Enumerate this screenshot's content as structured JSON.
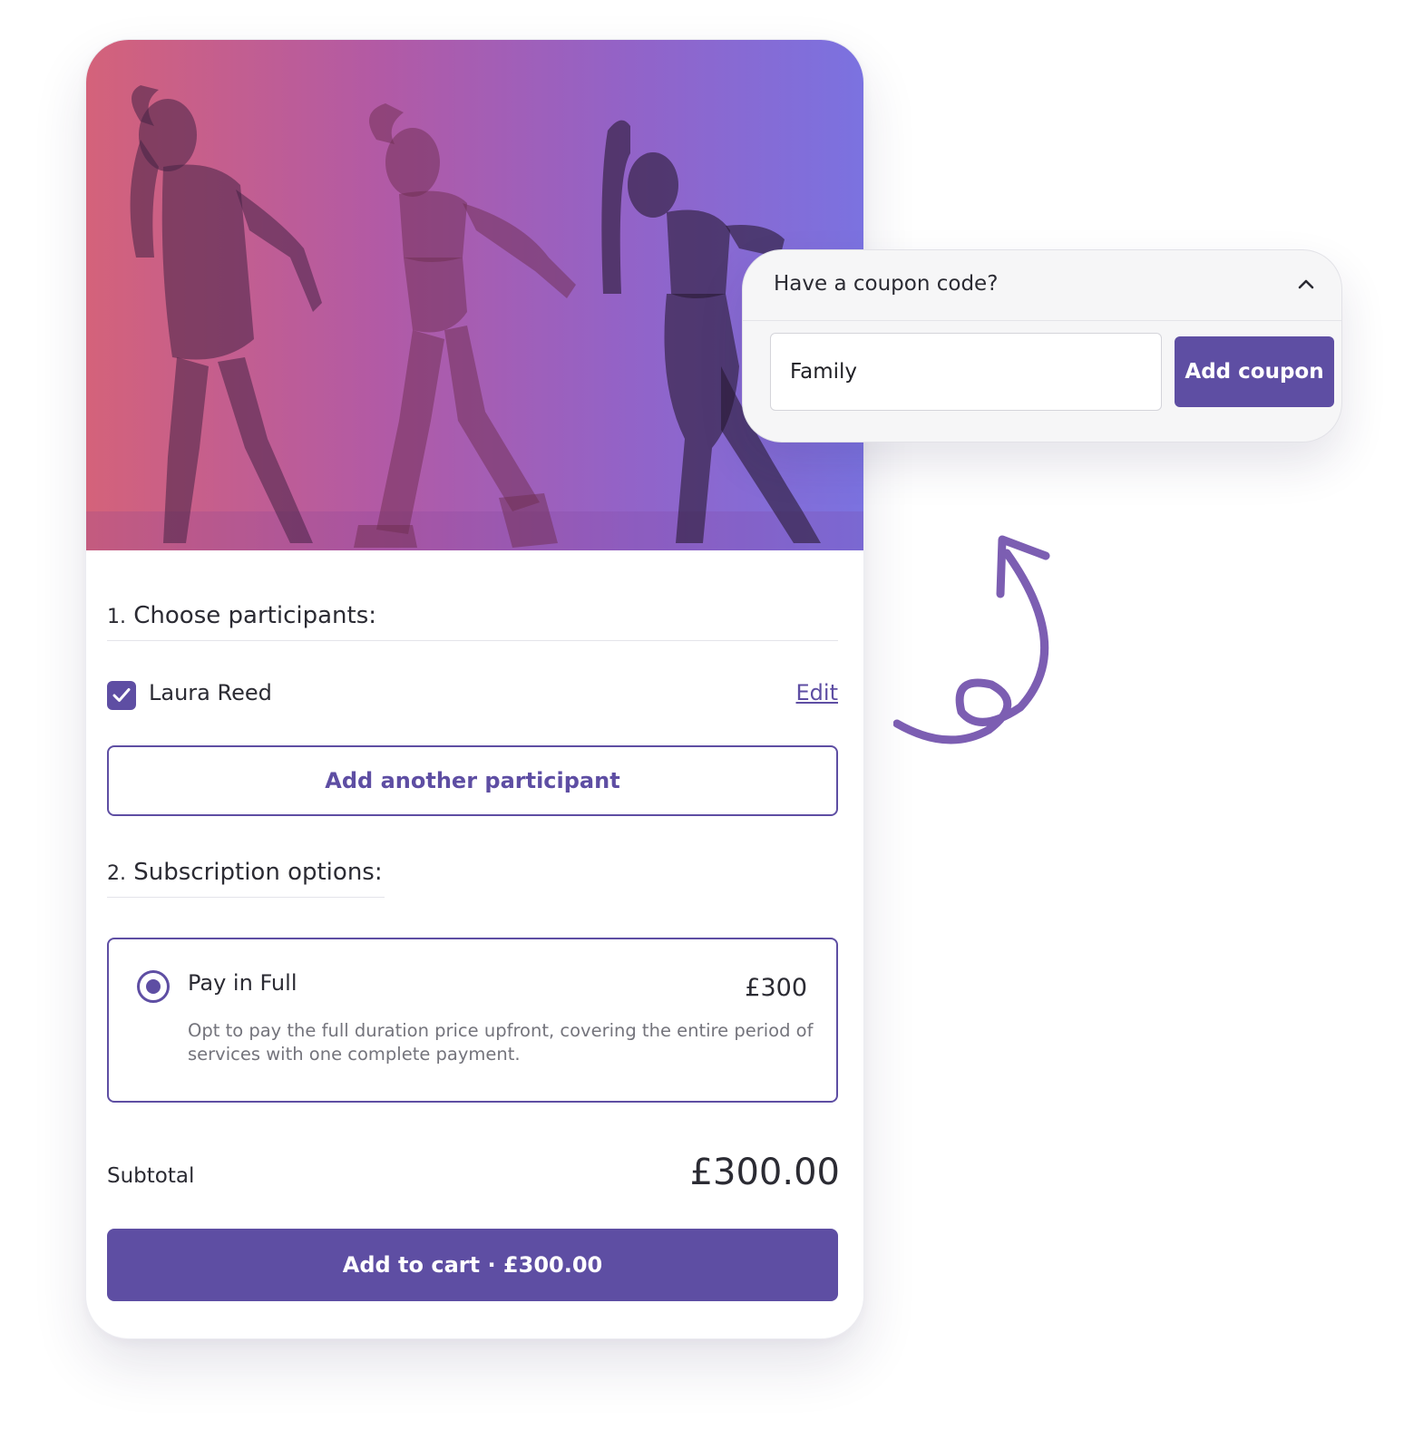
{
  "hero_image": {
    "description_icon": "dancers-photo"
  },
  "participants": {
    "title_number": "1.",
    "title_text": "Choose participants:",
    "items": [
      {
        "name": "Laura Reed",
        "checked": true,
        "edit_label": "Edit"
      }
    ],
    "add_label": "Add another participant"
  },
  "subscription": {
    "title_number": "2.",
    "title_text": "Subscription options:",
    "options": [
      {
        "title": "Pay in Full",
        "price": "£300",
        "description": "Opt to pay the full duration price upfront, covering the entire period of services with one complete payment.",
        "selected": true
      }
    ]
  },
  "summary": {
    "subtotal_label": "Subtotal",
    "subtotal_value": "£300.00",
    "cart_button_label": "Add to cart · £300.00"
  },
  "coupon": {
    "title": "Have a coupon code?",
    "input_value": "Family",
    "button_label": "Add coupon",
    "expanded": true
  },
  "colors": {
    "accent": "#5e4ea3",
    "hero_gradient_start": "#d4627a",
    "hero_gradient_end": "#7b72e0"
  }
}
